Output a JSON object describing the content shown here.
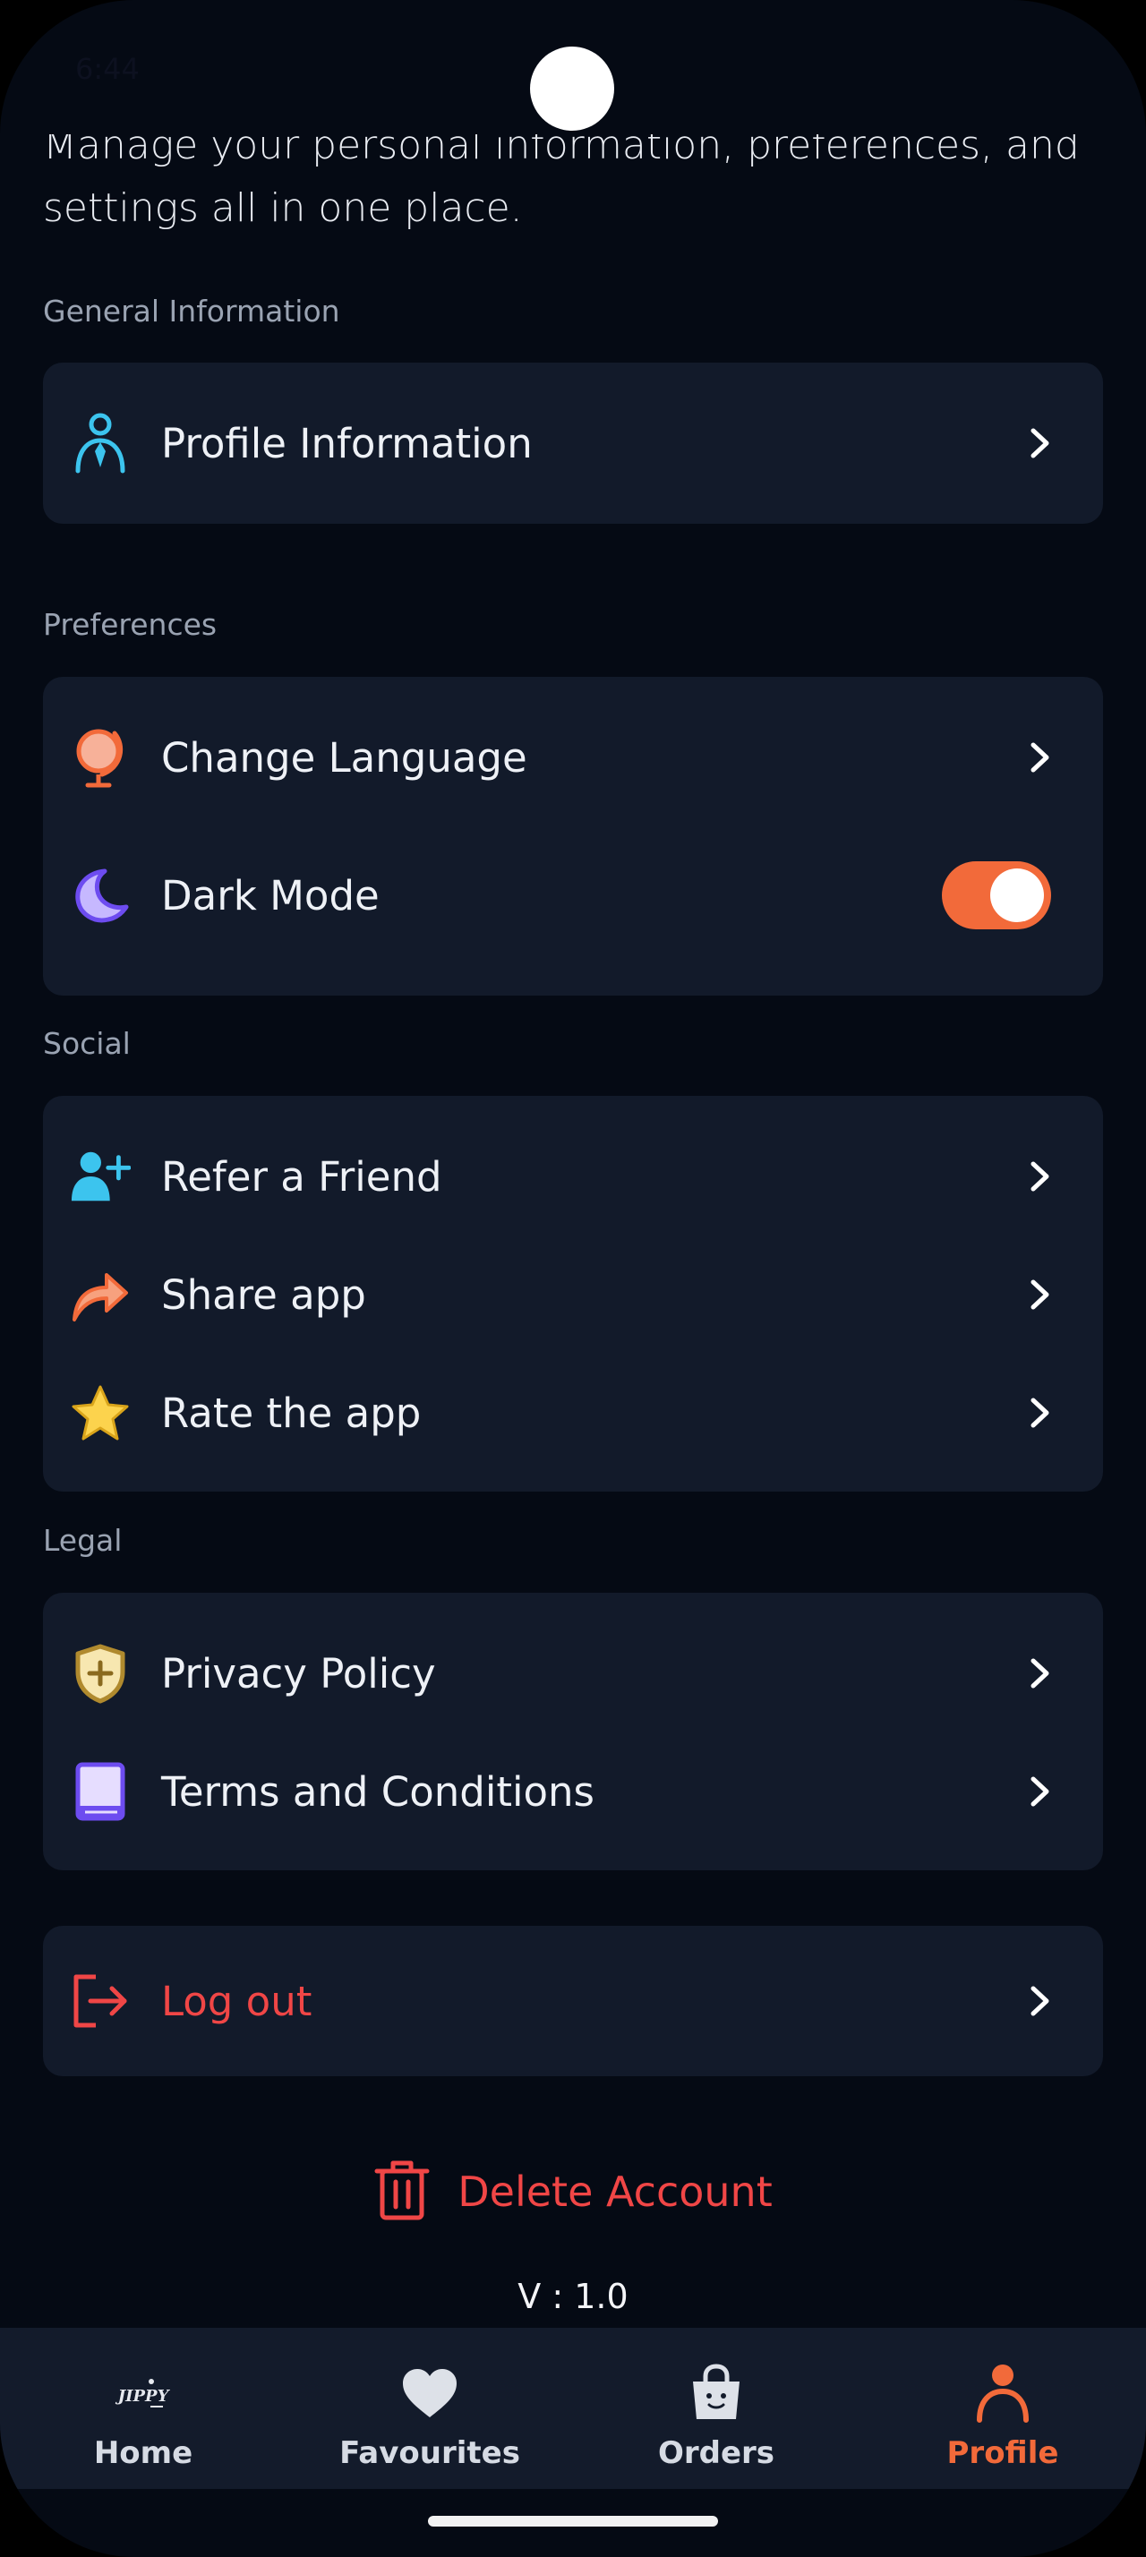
{
  "status_bar": {
    "time": "6:44"
  },
  "intro": {
    "line1": "Manage your personal information, preferences, and",
    "line2": "settings all in one place."
  },
  "sections": {
    "general": {
      "title": "General Information",
      "items": [
        {
          "label": "Profile Information",
          "icon": "person-tie-icon"
        }
      ]
    },
    "preferences": {
      "title": "Preferences",
      "items": [
        {
          "label": "Change Language",
          "icon": "globe-icon"
        },
        {
          "label": "Dark Mode",
          "icon": "moon-icon",
          "toggle_on": true
        }
      ]
    },
    "social": {
      "title": "Social",
      "items": [
        {
          "label": "Refer a Friend",
          "icon": "add-user-icon"
        },
        {
          "label": "Share app",
          "icon": "share-arrow-icon"
        },
        {
          "label": "Rate the app",
          "icon": "star-icon"
        }
      ]
    },
    "legal": {
      "title": "Legal",
      "items": [
        {
          "label": "Privacy Policy",
          "icon": "shield-plus-icon"
        },
        {
          "label": "Terms and Conditions",
          "icon": "book-icon"
        }
      ]
    }
  },
  "logout": {
    "label": "Log out",
    "icon": "logout-icon"
  },
  "delete_account": {
    "label": "Delete Account",
    "icon": "trash-icon"
  },
  "version": "V : 1.0",
  "bottom_nav": {
    "items": [
      {
        "label": "Home",
        "icon": "jippy-logo-icon",
        "logo_text": "JIPPY"
      },
      {
        "label": "Favourites",
        "icon": "heart-icon"
      },
      {
        "label": "Orders",
        "icon": "shopping-bag-icon"
      },
      {
        "label": "Profile",
        "icon": "person-icon",
        "active": true
      }
    ]
  },
  "colors": {
    "background": "#050a14",
    "card": "#121a2a",
    "accent": "#f26a3a",
    "danger": "#f04646",
    "muted_text": "#9aa3b2"
  }
}
